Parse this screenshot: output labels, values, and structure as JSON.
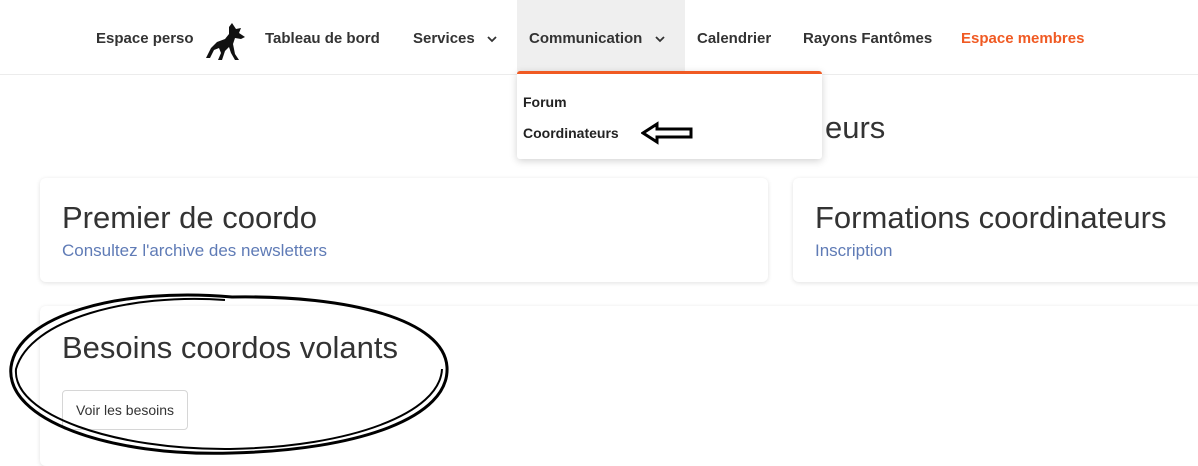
{
  "nav": {
    "items": [
      {
        "label": "Espace perso"
      },
      {
        "label": "Tableau de bord"
      },
      {
        "label": "Services"
      },
      {
        "label": "Communication"
      },
      {
        "label": "Calendrier"
      },
      {
        "label": "Rayons Fantômes"
      },
      {
        "label": "Espace membres"
      }
    ],
    "logo_icon": "wolf-icon",
    "accent_color": "#f05a23"
  },
  "dropdown": {
    "items": [
      {
        "label": "Forum"
      },
      {
        "label": "Coordinateurs"
      }
    ],
    "annotation_icon": "left-arrow-icon"
  },
  "page": {
    "title_fragment": "eurs"
  },
  "cards": [
    {
      "title": "Premier de coordo",
      "link": "Consultez l'archive des newsletters"
    },
    {
      "title": "Formations coordinateurs",
      "link": "Inscription"
    },
    {
      "title": "Besoins coordos volants",
      "button": "Voir les besoins"
    }
  ],
  "annotation": {
    "shape": "hand-drawn-ellipse"
  }
}
